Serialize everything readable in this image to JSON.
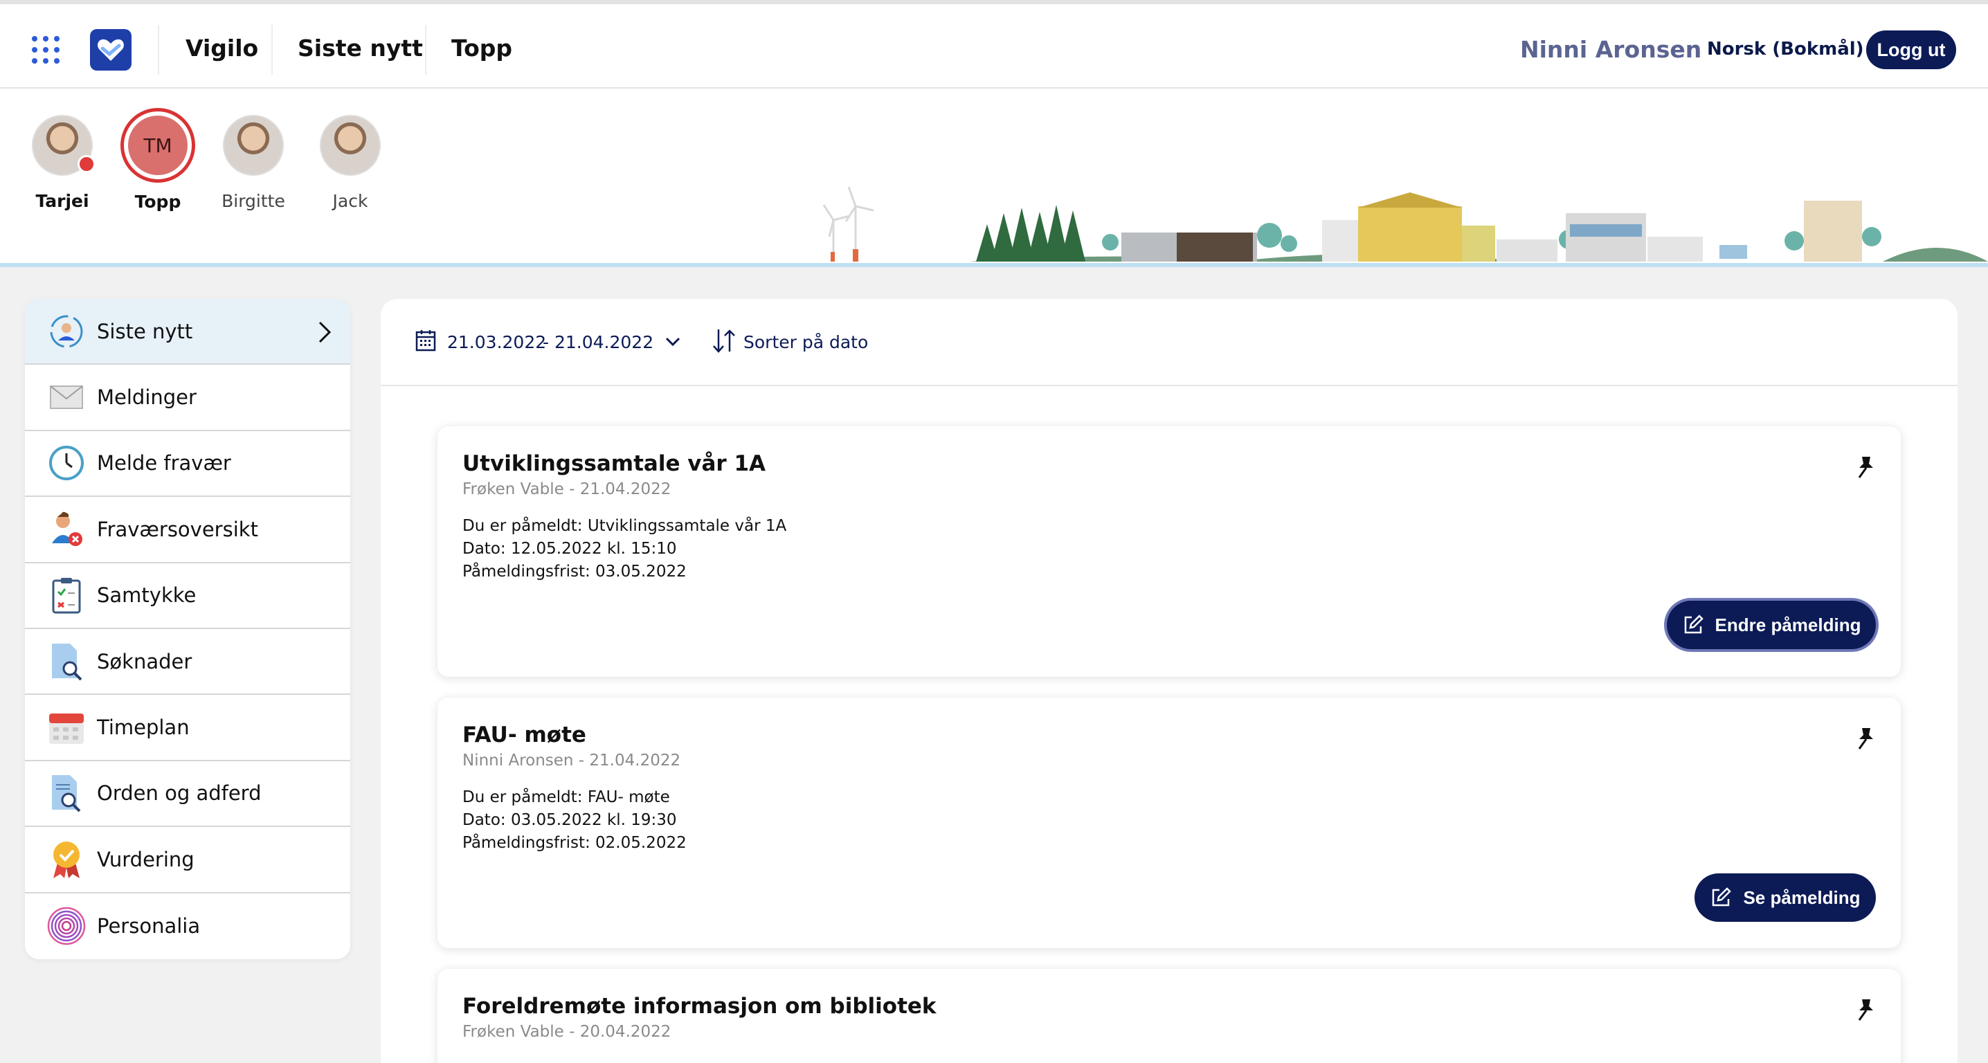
{
  "header": {
    "nav": [
      "Vigilo",
      "Siste nytt",
      "Topp"
    ],
    "user_name": "Ninni Aronsen",
    "language": "Norsk (Bokmål)",
    "logout_label": "Logg ut"
  },
  "children": [
    {
      "name": "Tarjei",
      "avatar": "photo",
      "notification": true
    },
    {
      "name": "Topp",
      "initials": "TM",
      "selected": true
    },
    {
      "name": "Birgitte",
      "avatar": "photo"
    },
    {
      "name": "Jack",
      "avatar": "photo"
    }
  ],
  "sidebar": {
    "items": [
      {
        "label": "Siste nytt",
        "icon": "news-person-icon",
        "active": true
      },
      {
        "label": "Meldinger",
        "icon": "envelope-icon"
      },
      {
        "label": "Melde fravær",
        "icon": "clock-icon"
      },
      {
        "label": "Fraværsoversikt",
        "icon": "absence-person-icon"
      },
      {
        "label": "Samtykke",
        "icon": "clipboard-check-icon"
      },
      {
        "label": "Søknader",
        "icon": "document-search-icon"
      },
      {
        "label": "Timeplan",
        "icon": "calendar-icon"
      },
      {
        "label": "Orden og adferd",
        "icon": "document-magnify-icon"
      },
      {
        "label": "Vurdering",
        "icon": "medal-icon"
      },
      {
        "label": "Personalia",
        "icon": "fingerprint-icon"
      }
    ]
  },
  "filter": {
    "date_from": "21.03.2022",
    "date_to": "- 21.04.2022",
    "sort_label": "Sorter på dato"
  },
  "cards": [
    {
      "title": "Utviklingssamtale vår 1A",
      "meta": "Frøken Vable - 21.04.2022",
      "lines": [
        "Du er påmeldt: Utviklingssamtale vår 1A",
        "Dato: 12.05.2022 kl. 15:10",
        "Påmeldingsfrist: 03.05.2022"
      ],
      "button": "Endre påmelding"
    },
    {
      "title": "FAU- møte",
      "meta": "Ninni Aronsen - 21.04.2022",
      "lines": [
        "Du er påmeldt: FAU- møte",
        "Dato: 03.05.2022 kl. 19:30",
        "Påmeldingsfrist: 02.05.2022"
      ],
      "button": "Se påmelding"
    },
    {
      "title": "Foreldremøte informasjon om bibliotek",
      "meta": "Frøken Vable - 20.04.2022"
    }
  ],
  "colors": {
    "navy": "#0c1b56",
    "accent_blue": "#2b5bd7",
    "active_bg": "#e6f1f8",
    "selected_ring": "#d93333"
  }
}
